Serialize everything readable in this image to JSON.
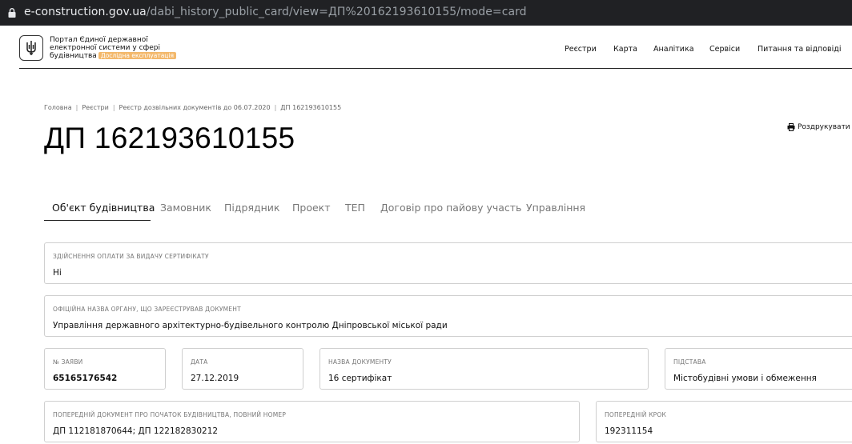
{
  "browser": {
    "url_host": "e-construction.gov.ua",
    "url_path": "/dabi_history_public_card/view=ДП%20162193610155/mode=card"
  },
  "header": {
    "portal_line1": "Портал Єдиної державної",
    "portal_line2": "електронної системи у сфері",
    "portal_line3": "будівництва",
    "badge": "Дослідна експлуатація",
    "nav": [
      "Реєстри",
      "Карта",
      "Аналітика",
      "Сервіси",
      "Питання та відповіді"
    ]
  },
  "breadcrumb": [
    "Головна",
    "Реєстри",
    "Реєстр дозвільних документів до 06.07.2020",
    "ДП 162193610155"
  ],
  "page_title": "ДП 162193610155",
  "print_label": "Роздрукувати",
  "tabs": [
    "Об'єкт будівництва",
    "Замовник",
    "Підрядник",
    "Проект",
    "ТЕП",
    "Договір про пайову участь",
    "Управління"
  ],
  "fields": {
    "payment": {
      "label": "Здійснення оплати за видачу сертифікату",
      "value": "Ні"
    },
    "authority": {
      "label": "Офіційна назва органу, що зареєстрував документ",
      "value": "Управління державного архітектурно-будівельного контролю Дніпровської міської ради"
    },
    "app_no": {
      "label": "№ заяви",
      "value": "65165176542"
    },
    "date": {
      "label": "Дата",
      "value": "27.12.2019"
    },
    "doc_name": {
      "label": "Назва документу",
      "value": "16 сертифікат"
    },
    "basis": {
      "label": "Підстава",
      "value": "Містобудівні умови і обмеження"
    },
    "prev_doc": {
      "label": "Попередній документ про початок будівництва, повний номер",
      "value": "ДП 112181870644; ДП 122182830212"
    },
    "prev_step": {
      "label": "Попередній крок",
      "value": "192311154"
    }
  }
}
